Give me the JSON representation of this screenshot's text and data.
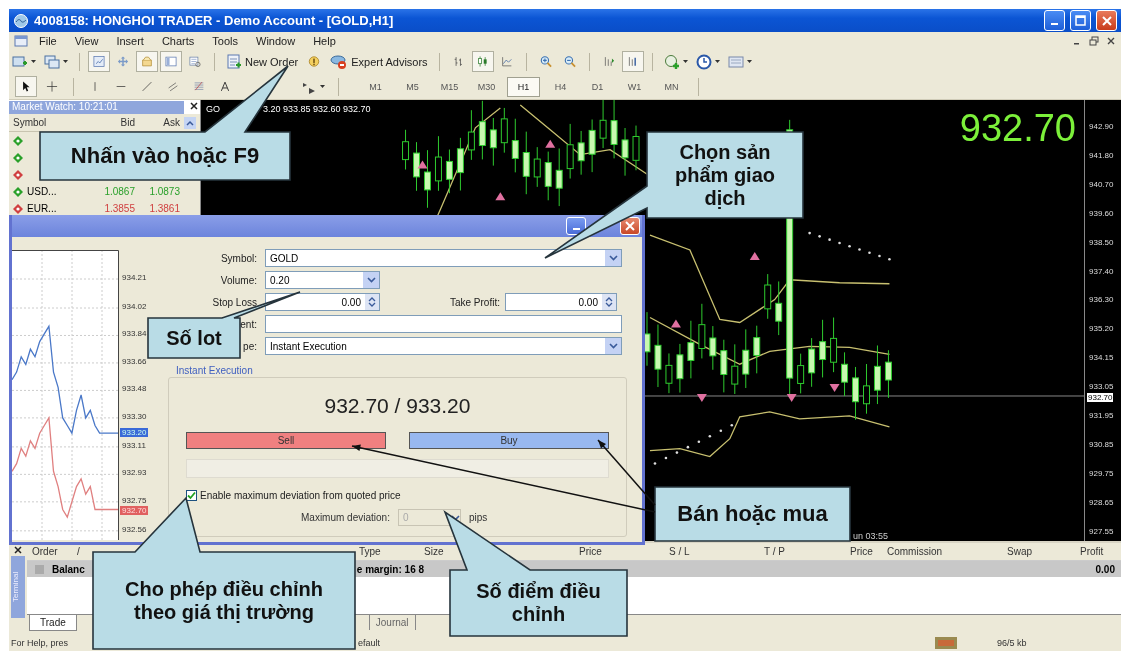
{
  "window": {
    "title": "4008158: HONGHOI TRADER - Demo Account - [GOLD,H1]"
  },
  "menu": [
    {
      "label": "File"
    },
    {
      "label": "View"
    },
    {
      "label": "Insert"
    },
    {
      "label": "Charts"
    },
    {
      "label": "Tools"
    },
    {
      "label": "Window"
    },
    {
      "label": "Help"
    }
  ],
  "toolbar": {
    "new_order": "New Order",
    "expert_advisors": "Expert Advisors"
  },
  "timeframes": [
    {
      "label": "M1",
      "selected": false
    },
    {
      "label": "M5",
      "selected": false
    },
    {
      "label": "M15",
      "selected": false
    },
    {
      "label": "M30",
      "selected": false
    },
    {
      "label": "H1",
      "selected": true
    },
    {
      "label": "H4",
      "selected": false
    },
    {
      "label": "D1",
      "selected": false
    },
    {
      "label": "W1",
      "selected": false
    },
    {
      "label": "MN",
      "selected": false
    }
  ],
  "market_watch": {
    "title": "Market Watch: 10:21:01",
    "columns": [
      "Symbol",
      "Bid",
      "Ask"
    ],
    "rows": [
      {
        "color": "#2aa02a"
      },
      {
        "color": "#2aa02a"
      },
      {
        "color": "#d04040"
      },
      {
        "symbol": "USD...",
        "bid": "1.0867",
        "ask": "1.0873",
        "color": "#2aa02a"
      },
      {
        "symbol": "EUR...",
        "bid": "1.3855",
        "ask": "1.3861",
        "color": "#d04040"
      }
    ]
  },
  "chart": {
    "header_left": "GO",
    "header_right": "3.20 933.85 932.60 932.70",
    "price": "932.70",
    "time_label": "un 03:55",
    "axis": [
      {
        "label": "942.90",
        "kind": "tick"
      },
      {
        "label": "941.80",
        "kind": "tick"
      },
      {
        "label": "940.70",
        "kind": "tick"
      },
      {
        "label": "939.60",
        "kind": "tick"
      },
      {
        "label": "938.50",
        "kind": "tick"
      },
      {
        "label": "937.40",
        "kind": "tick"
      },
      {
        "label": "936.30",
        "kind": "tick"
      },
      {
        "label": "935.20",
        "kind": "tick"
      },
      {
        "label": "934.15",
        "kind": "tick"
      },
      {
        "label": "933.05",
        "kind": "tick"
      },
      {
        "label": "932.70",
        "kind": "current"
      },
      {
        "label": "931.95",
        "kind": "tick"
      },
      {
        "label": "930.85",
        "kind": "tick"
      },
      {
        "label": "929.75",
        "kind": "tick"
      },
      {
        "label": "928.65",
        "kind": "tick"
      },
      {
        "label": "927.55",
        "kind": "tick"
      }
    ]
  },
  "order_dialog": {
    "mini_chart": {
      "chart_data": {
        "type": "line",
        "grid": true,
        "ylim": [
          932.5,
          934.4
        ],
        "yticks": [
          934.21,
          934.02,
          933.84,
          933.66,
          933.48,
          {
            "value": 933.3,
            "label": "933.30"
          },
          933.11,
          932.93,
          932.75,
          932.56
        ],
        "series": [
          {
            "color": "#4a78c8",
            "values": [
              933.55,
              933.6,
              933.7,
              933.65,
              933.75,
              933.7,
              933.8,
              933.85,
              933.9,
              933.6,
              933.5,
              933.3,
              933.25,
              933.2,
              933.35,
              933.45,
              933.3,
              933.35,
              933.25,
              933.2,
              933.2,
              933.2,
              933.2,
              933.2
            ]
          },
          {
            "color": "#e08080",
            "values": [
              932.95,
              933.0,
              933.1,
              933.05,
              933.15,
              933.1,
              933.2,
              933.25,
              933.3,
              932.95,
              932.85,
              932.7,
              932.65,
              932.75,
              932.85,
              932.9,
              932.8,
              932.85,
              932.7,
              932.7,
              932.7,
              932.7,
              932.7,
              932.7
            ]
          }
        ]
      },
      "badges": [
        {
          "label": "933.20",
          "kind": "ask"
        },
        {
          "label": "932.70",
          "kind": "bid"
        }
      ]
    },
    "symbol": {
      "label": "Symbol:",
      "value": "GOLD"
    },
    "volume": {
      "label": "Volume:",
      "value": "0.20"
    },
    "stop_loss": {
      "label": "Stop Loss",
      "value": "0.00"
    },
    "take_profit": {
      "label": "Take Profit:",
      "value": "0.00"
    },
    "comment": {
      "label": "ent:"
    },
    "type": {
      "label": "pe:",
      "value": "Instant Execution"
    },
    "execution": {
      "title": "Instant Execution",
      "quote": "932.70 / 933.20",
      "sell": "Sell",
      "buy": "Buy",
      "deviation": {
        "label": "Enable maximum deviation from quoted price",
        "checked": true
      },
      "max_deviation": {
        "label": "Maximum deviation:",
        "value": "0",
        "unit": "pips",
        "disabled": true
      }
    }
  },
  "terminal": {
    "title": "Terminal",
    "columns": [
      "Order",
      "/",
      "Type",
      "Size",
      "Price",
      "S / L",
      "T / P",
      "Price",
      "Commission",
      "Swap",
      "Profit"
    ],
    "row": {
      "cells": [
        "Balanc",
        "e margin: 16 8",
        "0.00"
      ]
    },
    "tabs": [
      {
        "label": "Trade",
        "selected": true
      },
      {
        "label": "Journal",
        "selected": false
      }
    ]
  },
  "status_bar": [
    "For Help, pres",
    "efault",
    "96/5 kb"
  ],
  "callouts": [
    {
      "text": "Nhấn vào hoặc F9"
    },
    {
      "text": "Chọn sản phẩm giao dịch"
    },
    {
      "text": "Số lot"
    },
    {
      "text": "Bán hoặc mua"
    },
    {
      "text": "Cho phép điều chỉnh theo giá thị trường"
    },
    {
      "text": "Số điểm điều chỉnh"
    }
  ]
}
